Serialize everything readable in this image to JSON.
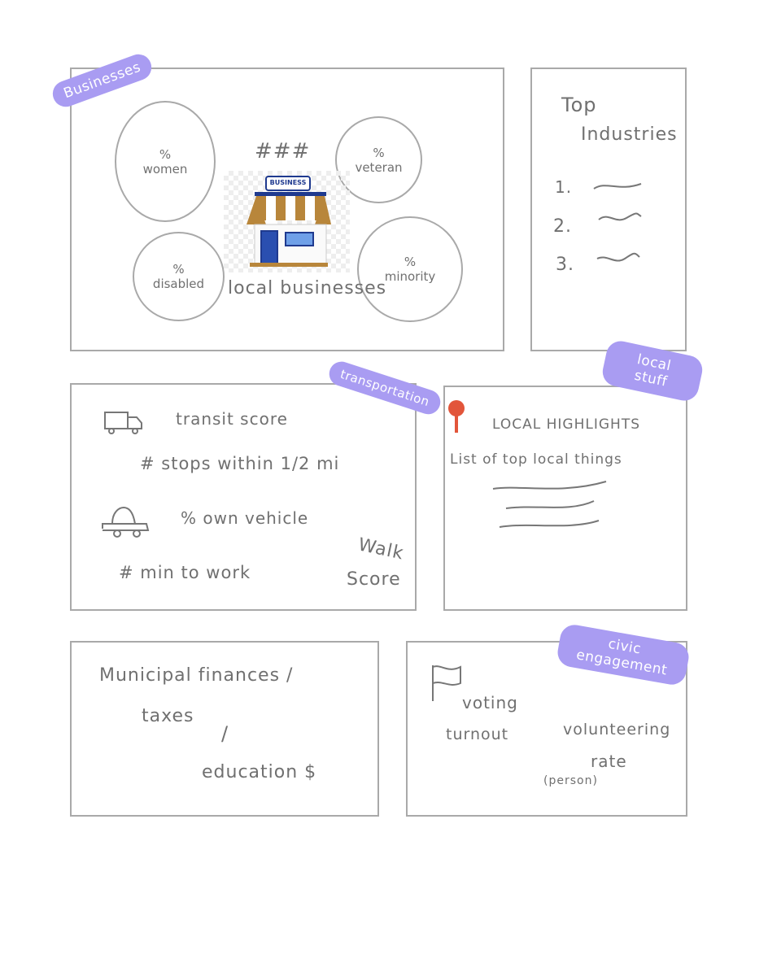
{
  "businesses": {
    "tag": "Businesses",
    "count": "###",
    "caption": "local businesses",
    "store_sign": "BUSINESS",
    "circles": [
      {
        "pct": "%",
        "label": "women"
      },
      {
        "pct": "%",
        "label": "veteran"
      },
      {
        "pct": "%",
        "label": "disabled"
      },
      {
        "pct": "%",
        "label": "minority"
      }
    ]
  },
  "industries": {
    "title_line1": "Top",
    "title_line2": "Industries",
    "items": [
      "1.",
      "2.",
      "3."
    ]
  },
  "transportation": {
    "tag": "transportation",
    "transit": "transit score",
    "stops": "#  stops within 1/2 mi",
    "vehicle": "%  own vehicle",
    "walk_line1": "Walk",
    "commute": "#  min  to  work",
    "walk_line2": "Score"
  },
  "local": {
    "tag_line1": "local",
    "tag_line2": "stuff",
    "title": "LOCAL HIGHLIGHTS",
    "subtitle": "List of top  local  things"
  },
  "finances": {
    "line1": "Municipal finances /",
    "line2": "taxes",
    "line3": "/",
    "line4": "education $"
  },
  "civic": {
    "tag_line1": "civic",
    "tag_line2": "engagement",
    "voting_line1": "voting",
    "voting_line2": "turnout",
    "volunteer_line1": "volunteering",
    "volunteer_line2": "rate",
    "volunteer_note": "(person)"
  },
  "colors": {
    "tag": "#a99cf2",
    "border": "#a9a9a9",
    "pin": "#e2553a",
    "awning_brown": "#b8863b",
    "store_blue": "#1f3a8f"
  }
}
